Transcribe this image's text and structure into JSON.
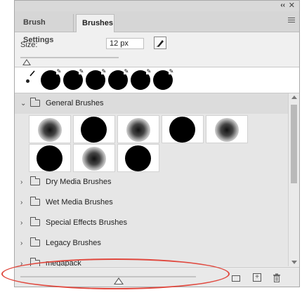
{
  "panel": {
    "collapse_glyph": "‹‹",
    "close_glyph": "✕"
  },
  "tabs": [
    {
      "label": "Brush Settings"
    },
    {
      "label": "Brushes"
    }
  ],
  "size": {
    "label": "Size:",
    "value": "12 px"
  },
  "groups": [
    {
      "label": "General Brushes",
      "expanded": true
    },
    {
      "label": "Dry Media Brushes",
      "expanded": false
    },
    {
      "label": "Wet Media Brushes",
      "expanded": false
    },
    {
      "label": "Special Effects Brushes",
      "expanded": false
    },
    {
      "label": "Legacy Brushes",
      "expanded": false
    },
    {
      "label": "megapack",
      "expanded": false
    }
  ],
  "general_brush_tips": [
    "soft",
    "hard",
    "soft",
    "hard",
    "soft",
    "hard",
    "soft",
    "hard"
  ],
  "recent_brushes": [
    "hard",
    "hard",
    "hard",
    "hard",
    "hard",
    "hard"
  ],
  "glyphs": {
    "chevron_open": "⌄",
    "chevron_closed": "›",
    "new_brush": "+",
    "trash": "🗑"
  },
  "annotation_color": "#e0483e"
}
